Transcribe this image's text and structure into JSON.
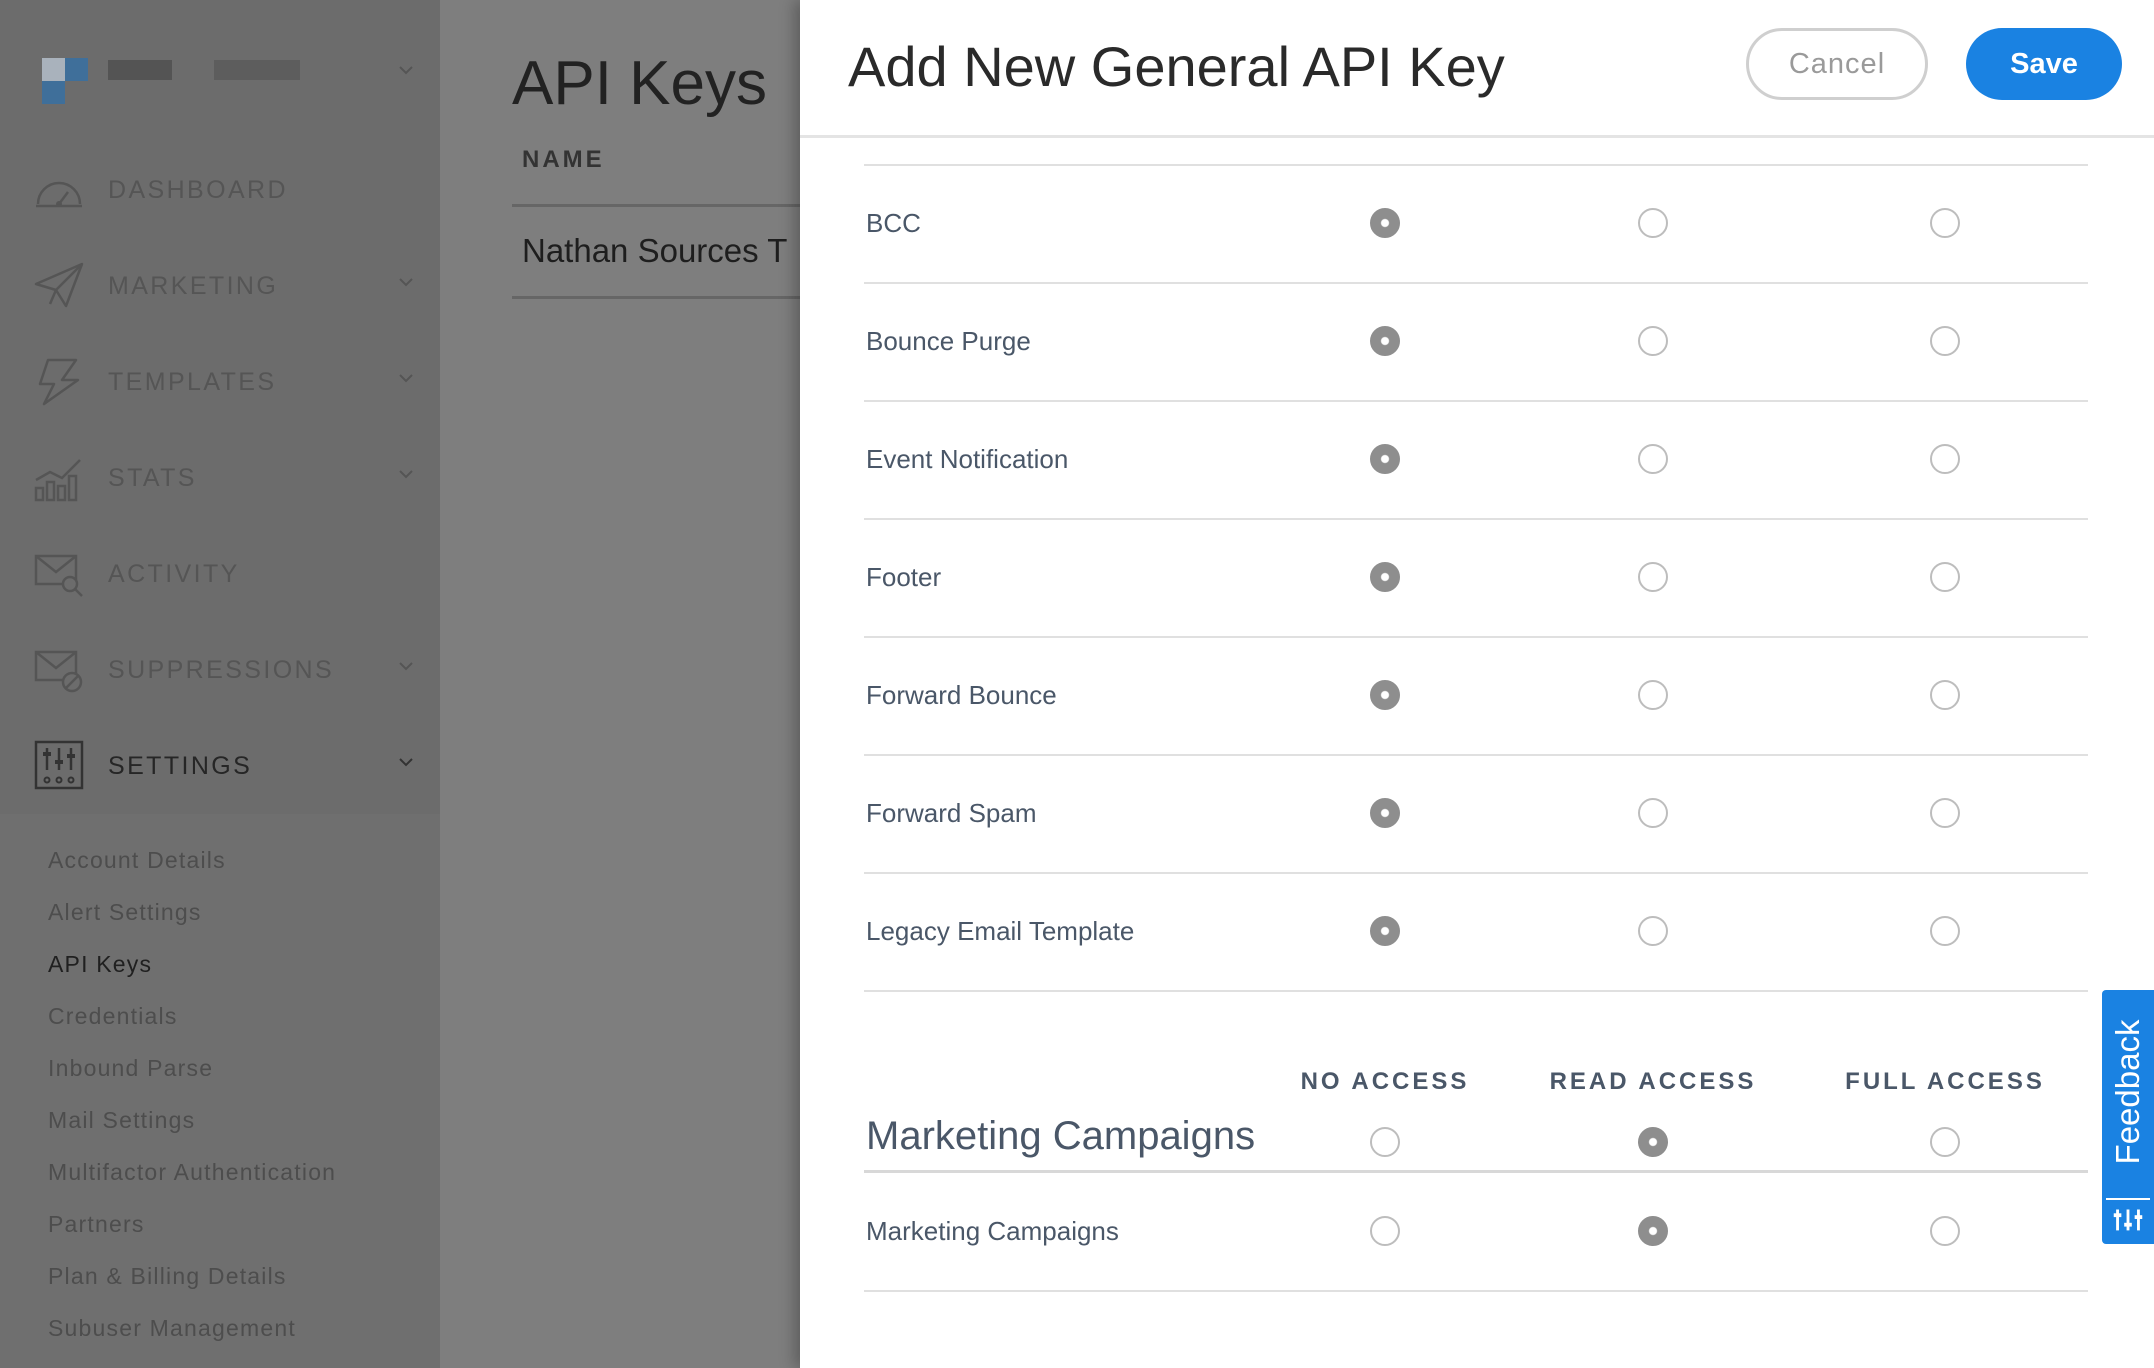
{
  "colors": {
    "accent": "#1a82e2",
    "overlay": "#7d7d7d",
    "label": "#4a5768"
  },
  "sidebar": {
    "nav": [
      {
        "label": "DASHBOARD",
        "icon": "dashboard-icon",
        "chevron": false
      },
      {
        "label": "MARKETING",
        "icon": "paper-plane-icon",
        "chevron": true
      },
      {
        "label": "TEMPLATES",
        "icon": "templates-icon",
        "chevron": true
      },
      {
        "label": "STATS",
        "icon": "stats-icon",
        "chevron": true
      },
      {
        "label": "ACTIVITY",
        "icon": "activity-search-icon",
        "chevron": false
      },
      {
        "label": "SUPPRESSIONS",
        "icon": "suppressions-icon",
        "chevron": true
      },
      {
        "label": "SETTINGS",
        "icon": "settings-sliders-icon",
        "chevron": true,
        "active": true
      }
    ],
    "settings_items": [
      "Account Details",
      "Alert Settings",
      "API Keys",
      "Credentials",
      "Inbound Parse",
      "Mail Settings",
      "Multifactor Authentication",
      "Partners",
      "Plan & Billing Details",
      "Subuser Management"
    ],
    "settings_active": "API Keys"
  },
  "main": {
    "title": "API Keys",
    "column_name": "NAME",
    "row_name": "Nathan Sources T"
  },
  "modal": {
    "title": "Add New General API Key",
    "cancel_label": "Cancel",
    "save_label": "Save",
    "permissions": [
      {
        "label": "BCC",
        "access": "none"
      },
      {
        "label": "Bounce Purge",
        "access": "none"
      },
      {
        "label": "Event Notification",
        "access": "none"
      },
      {
        "label": "Footer",
        "access": "none"
      },
      {
        "label": "Forward Bounce",
        "access": "none"
      },
      {
        "label": "Forward Spam",
        "access": "none"
      },
      {
        "label": "Legacy Email Template",
        "access": "none"
      }
    ],
    "columns": {
      "none": "NO ACCESS",
      "read": "READ ACCESS",
      "full": "FULL ACCESS"
    },
    "section": {
      "title": "Marketing Campaigns",
      "access": "read",
      "rows": [
        {
          "label": "Marketing Campaigns",
          "access": "read"
        }
      ]
    }
  },
  "feedback": {
    "label": "Feedback"
  }
}
